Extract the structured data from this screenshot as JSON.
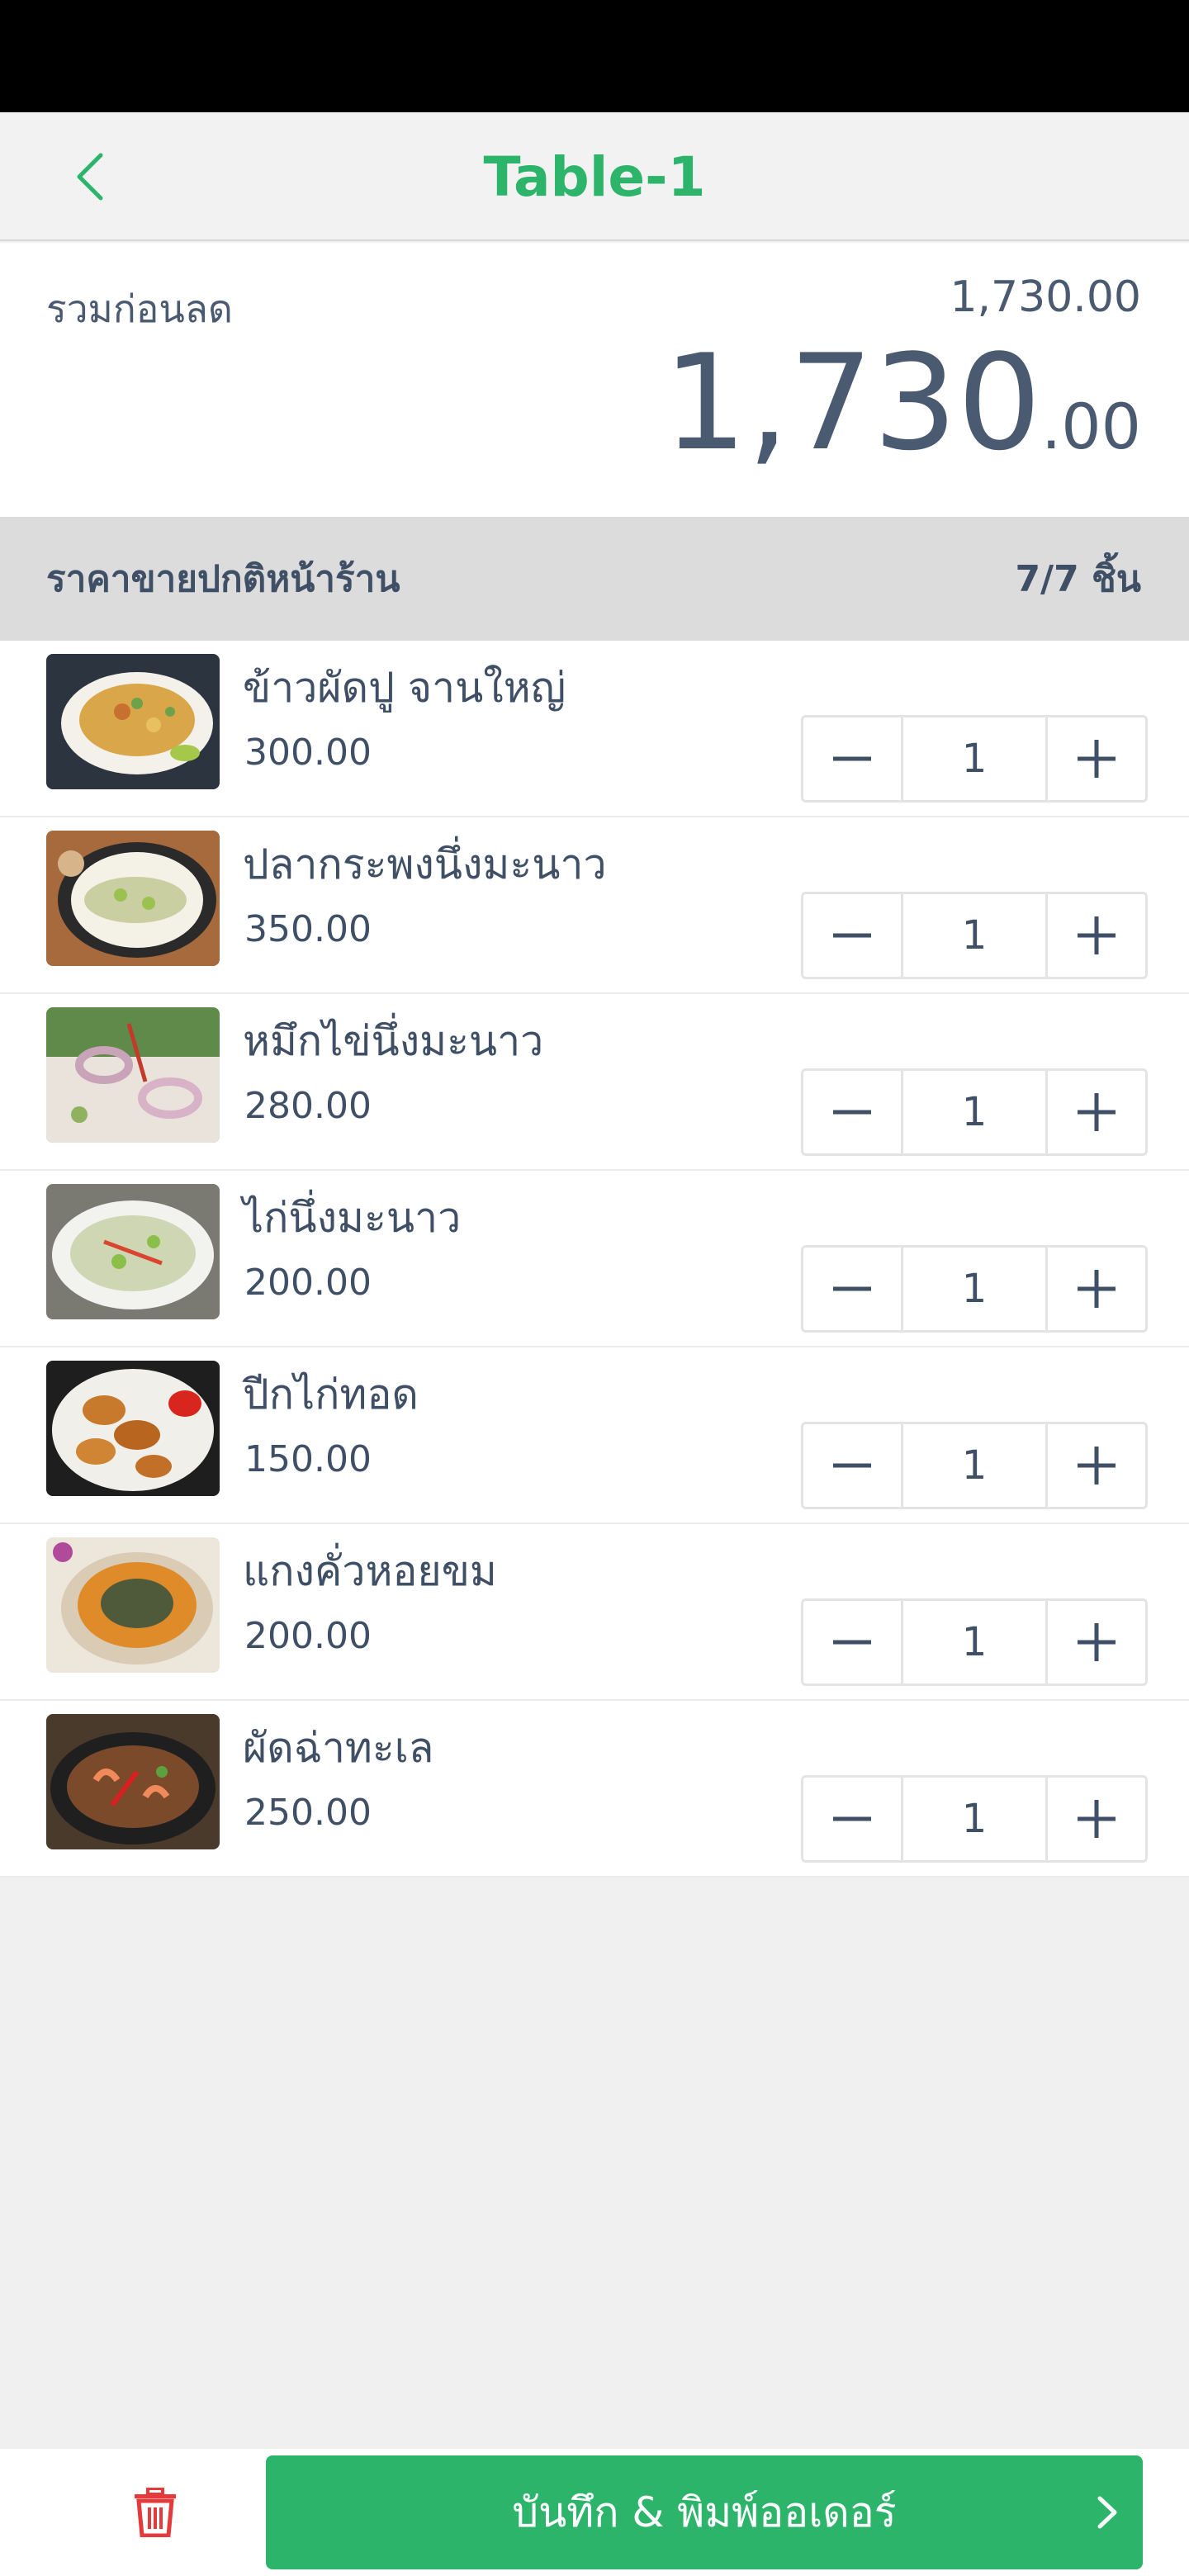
{
  "nav": {
    "title": "Table-1",
    "back_icon": "chevron-left-icon"
  },
  "summary": {
    "subtotal_label": "รวมก่อนลด",
    "subtotal_value": "1,730.00",
    "grand_total_int": "1,730",
    "grand_total_dec": ".00"
  },
  "section": {
    "title": "ราคาขายปกติหน้าร้าน",
    "count": "7/7 ชิ้น"
  },
  "items": [
    {
      "name": "ข้าวผัดปู จานใหญ่",
      "price": "300.00",
      "qty": "1",
      "image": "crab-fried-rice-photo"
    },
    {
      "name": "ปลากระพงนึ่งมะนาว",
      "price": "350.00",
      "qty": "1",
      "image": "steamed-sea-bass-lime-photo"
    },
    {
      "name": "หมึกไข่นึ่งมะนาว",
      "price": "280.00",
      "qty": "1",
      "image": "steamed-squid-lime-photo"
    },
    {
      "name": "ไก่นึ่งมะนาว",
      "price": "200.00",
      "qty": "1",
      "image": "steamed-chicken-lime-photo"
    },
    {
      "name": "ปีกไก่ทอด",
      "price": "150.00",
      "qty": "1",
      "image": "fried-chicken-wings-photo"
    },
    {
      "name": "แกงคั่วหอยขม",
      "price": "200.00",
      "qty": "1",
      "image": "snail-curry-photo"
    },
    {
      "name": "ผัดฉ่าทะเล",
      "price": "250.00",
      "qty": "1",
      "image": "spicy-seafood-stir-fry-photo"
    }
  ],
  "bottom": {
    "delete_icon": "trash-icon",
    "submit_label": "บันทึก & พิมพ์ออเดอร์",
    "submit_icon": "chevron-right-icon"
  },
  "colors": {
    "accent": "#2bb46a",
    "text": "#3f4f66",
    "delete": "#e5393b"
  }
}
